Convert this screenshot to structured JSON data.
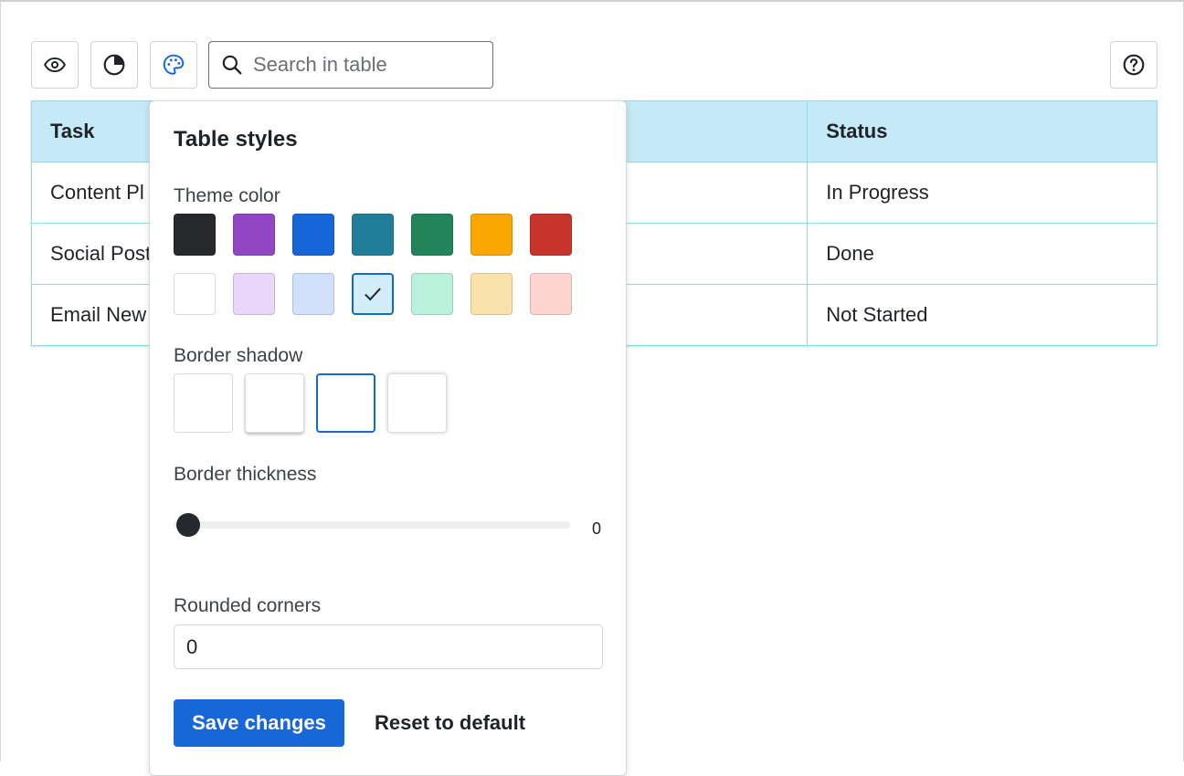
{
  "toolbar": {
    "search_placeholder": "Search in table",
    "icons": [
      "eye-icon",
      "chart-pie-icon",
      "palette-icon",
      "search-icon",
      "help-icon"
    ]
  },
  "table": {
    "headers": [
      "Task",
      "",
      "Status"
    ],
    "rows": [
      [
        "Content Pl",
        "",
        "In Progress"
      ],
      [
        "Social Post",
        "",
        "Done"
      ],
      [
        "Email New",
        "",
        "Not Started"
      ]
    ],
    "header_bg": "#c4e9f7",
    "border_color": "#98d6ea"
  },
  "popover": {
    "title": "Table styles",
    "theme_color_label": "Theme color",
    "theme_colors_dark": [
      "#27292d",
      "#9246c4",
      "#1766d9",
      "#207e99",
      "#22855a",
      "#fca600",
      "#c8342c"
    ],
    "theme_colors_light": [
      "#ffffff",
      "#ead5fb",
      "#d1e1fb",
      "#d2edfa",
      "#b9f1dd",
      "#fae3a8",
      "#fed4d1"
    ],
    "selected_theme": "#d2edfa",
    "border_shadow_label": "Border shadow",
    "border_shadow_selected": 3,
    "border_thickness_label": "Border thickness",
    "border_thickness_value": "0",
    "rounded_corners_label": "Rounded corners",
    "rounded_corners_value": "0",
    "save_label": "Save changes",
    "reset_label": "Reset to default"
  }
}
